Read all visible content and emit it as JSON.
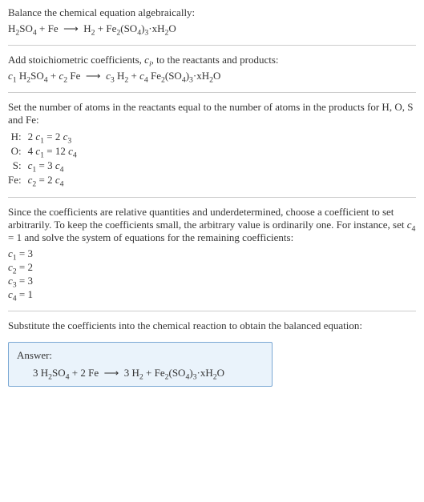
{
  "section1": {
    "title": "Balance the chemical equation algebraically:",
    "equation": "H₂SO₄ + Fe  ⟶  H₂ + Fe₂(SO₄)₃·xH₂O"
  },
  "section2": {
    "title_before": "Add stoichiometric coefficients, ",
    "title_ci": "cᵢ",
    "title_after": ", to the reactants and products:",
    "equation": "c₁ H₂SO₄ + c₂ Fe  ⟶  c₃ H₂ + c₄ Fe₂(SO₄)₃·xH₂O"
  },
  "section3": {
    "title": "Set the number of atoms in the reactants equal to the number of atoms in the products for H, O, S and Fe:",
    "rows": [
      {
        "label": "H:",
        "eq": "2 c₁ = 2 c₃"
      },
      {
        "label": "O:",
        "eq": "4 c₁ = 12 c₄"
      },
      {
        "label": "S:",
        "eq": "c₁ = 3 c₄"
      },
      {
        "label": "Fe:",
        "eq": "c₂ = 2 c₄"
      }
    ]
  },
  "section4": {
    "title": "Since the coefficients are relative quantities and underdetermined, choose a coefficient to set arbitrarily. To keep the coefficients small, the arbitrary value is ordinarily one. For instance, set c₄ = 1 and solve the system of equations for the remaining coefficients:",
    "coeffs": [
      "c₁ = 3",
      "c₂ = 2",
      "c₃ = 3",
      "c₄ = 1"
    ]
  },
  "section5": {
    "title": "Substitute the coefficients into the chemical reaction to obtain the balanced equation:"
  },
  "answer": {
    "label": "Answer:",
    "equation": "3 H₂SO₄ + 2 Fe  ⟶  3 H₂ + Fe₂(SO₄)₃·xH₂O"
  }
}
